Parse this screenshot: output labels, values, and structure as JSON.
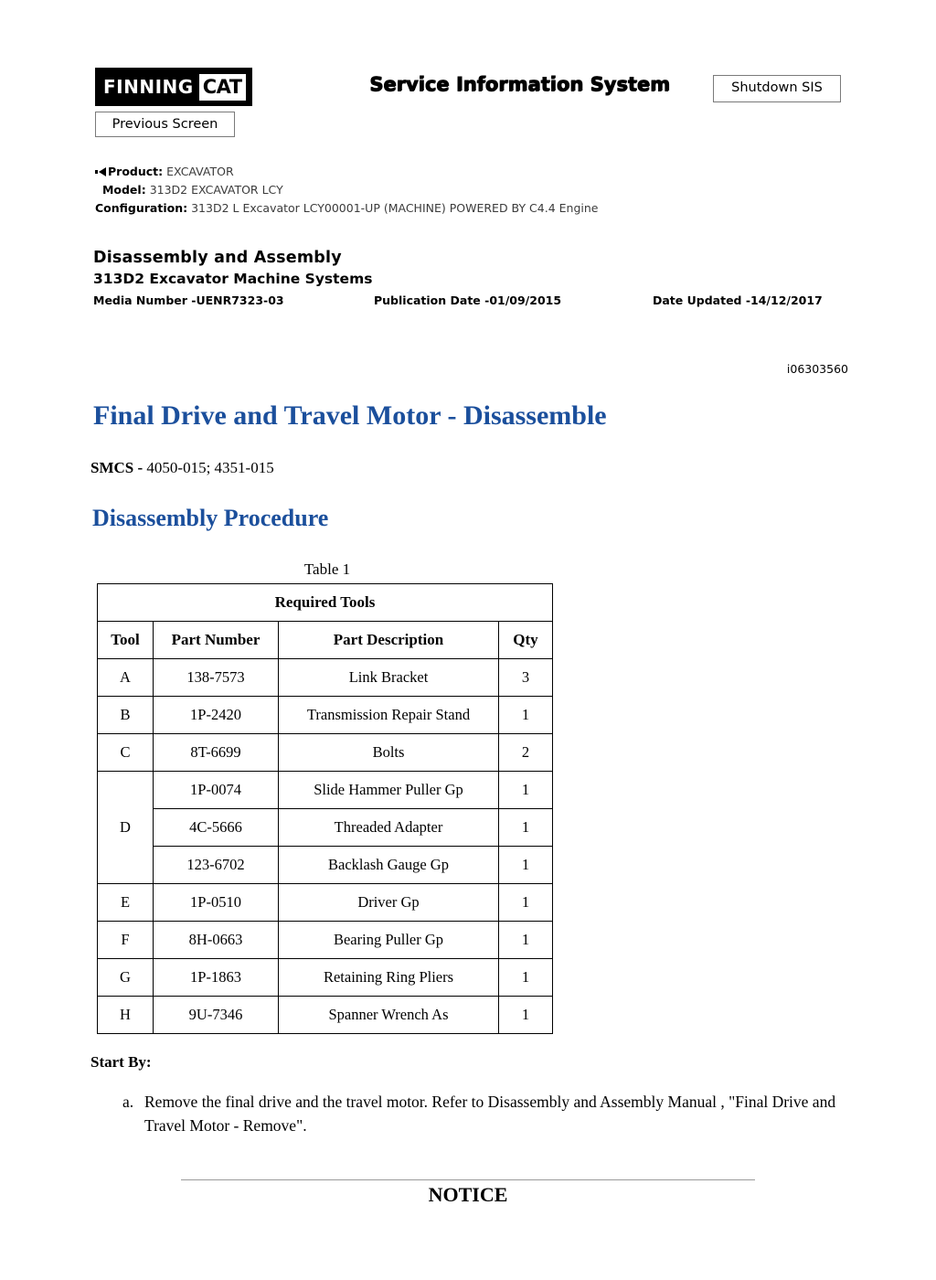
{
  "header": {
    "logo_primary": "FINNING",
    "logo_secondary": "CAT",
    "sis_title": "Service Information System",
    "shutdown_button": "Shutdown SIS",
    "previous_button": "Previous Screen"
  },
  "meta": {
    "product_label": "Product:",
    "product_value": "EXCAVATOR",
    "model_label": "Model:",
    "model_value": "313D2 EXCAVATOR LCY",
    "configuration_label": "Configuration:",
    "configuration_value": "313D2 L Excavator LCY00001-UP (MACHINE) POWERED BY C4.4 Engine"
  },
  "document": {
    "heading1": "Disassembly and Assembly",
    "heading2": "313D2 Excavator Machine Systems",
    "media_number": "Media Number -UENR7323-03",
    "publication_date": "Publication Date -01/09/2015",
    "date_updated": "Date Updated -14/12/2017",
    "doc_id": "i06303560",
    "title": "Final Drive and Travel Motor - Disassemble",
    "smcs_label": "SMCS -",
    "smcs_value": "4050-015; 4351-015",
    "section_title": "Disassembly Procedure"
  },
  "table": {
    "caption": "Table 1",
    "title": "Required Tools",
    "columns": [
      "Tool",
      "Part Number",
      "Part Description",
      "Qty"
    ],
    "rows": [
      {
        "tool": "A",
        "part": "138-7573",
        "desc": "Link Bracket",
        "qty": "3"
      },
      {
        "tool": "B",
        "part": "1P-2420",
        "desc": "Transmission Repair Stand",
        "qty": "1"
      },
      {
        "tool": "C",
        "part": "8T-6699",
        "desc": "Bolts",
        "qty": "2"
      },
      {
        "tool": "D",
        "part": "1P-0074",
        "desc": "Slide Hammer Puller Gp",
        "qty": "1"
      },
      {
        "tool": "",
        "part": "4C-5666",
        "desc": "Threaded Adapter",
        "qty": "1"
      },
      {
        "tool": "",
        "part": "123-6702",
        "desc": "Backlash Gauge Gp",
        "qty": "1"
      },
      {
        "tool": "E",
        "part": "1P-0510",
        "desc": "Driver Gp",
        "qty": "1"
      },
      {
        "tool": "F",
        "part": "8H-0663",
        "desc": "Bearing Puller Gp",
        "qty": "1"
      },
      {
        "tool": "G",
        "part": "1P-1863",
        "desc": "Retaining Ring Pliers",
        "qty": "1"
      },
      {
        "tool": "H",
        "part": "9U-7346",
        "desc": "Spanner Wrench As",
        "qty": "1"
      }
    ]
  },
  "procedure": {
    "start_by_label": "Start By:",
    "step_marker": "a.",
    "step_text": "Remove the final drive and the travel motor. Refer to Disassembly and Assembly Manual , \"Final Drive and Travel Motor - Remove\".",
    "notice": "NOTICE"
  },
  "colors": {
    "title_blue": "#1b4f9c",
    "text_black": "#000000",
    "meta_gray": "#3b3b3b"
  }
}
